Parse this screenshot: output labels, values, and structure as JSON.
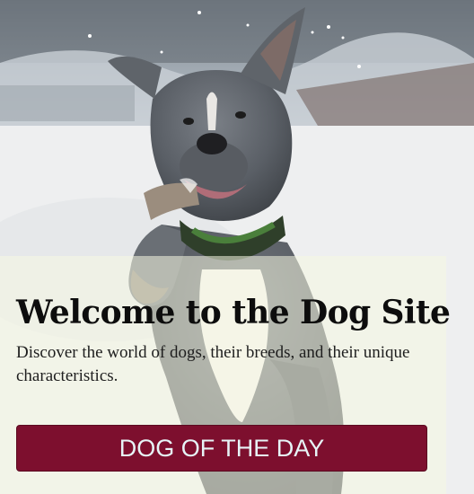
{
  "hero": {
    "image_alt": "Grey pit bull running through snow with a toy in its mouth",
    "title": "Welcome to the Dog Site",
    "subtitle": "Discover the world of dogs, their breeds, and their unique characteristics.",
    "cta_label": "DOG OF THE DAY"
  },
  "colors": {
    "cta_background": "#7d0f2e",
    "cta_text": "#e7f4f7",
    "overlay": "#f6f7e1"
  }
}
